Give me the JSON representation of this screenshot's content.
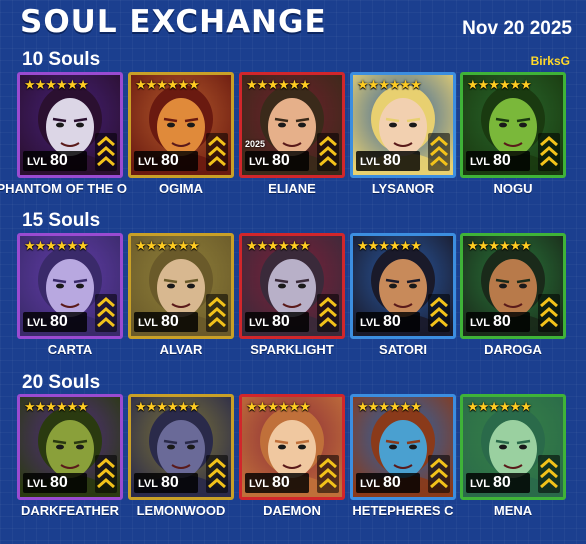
{
  "header": {
    "title": "SOUL EXCHANGE",
    "date": "Nov 20 2025",
    "user": "BirksG"
  },
  "sections": [
    {
      "label": "10 Souls",
      "heroes": [
        {
          "name": "PHANTOM OF THE O",
          "level": "80",
          "stars": 6,
          "frame": "#9a4bd1"
        },
        {
          "name": "OGIMA",
          "level": "80",
          "stars": 6,
          "frame": "#c9a027"
        },
        {
          "name": "ELIANE",
          "level": "80",
          "stars": 6,
          "frame": "#d1262b",
          "badge": "2025"
        },
        {
          "name": "LYSANOR",
          "level": "80",
          "stars": 6,
          "frame": "#3c8ee0"
        },
        {
          "name": "NOGU",
          "level": "80",
          "stars": 6,
          "frame": "#3fb338"
        }
      ]
    },
    {
      "label": "15 Souls",
      "heroes": [
        {
          "name": "CARTA",
          "level": "80",
          "stars": 6,
          "frame": "#9a4bd1"
        },
        {
          "name": "ALVAR",
          "level": "80",
          "stars": 6,
          "frame": "#c9a027"
        },
        {
          "name": "SPARKLIGHT",
          "level": "80",
          "stars": 6,
          "frame": "#d1262b"
        },
        {
          "name": "SATORI",
          "level": "80",
          "stars": 6,
          "frame": "#3c8ee0"
        },
        {
          "name": "DAROGA",
          "level": "80",
          "stars": 6,
          "frame": "#3fb338"
        }
      ]
    },
    {
      "label": "20 Souls",
      "heroes": [
        {
          "name": "DARKFEATHER",
          "level": "80",
          "stars": 6,
          "frame": "#9a4bd1"
        },
        {
          "name": "LEMONWOOD",
          "level": "80",
          "stars": 6,
          "frame": "#c9a027"
        },
        {
          "name": "DAEMON",
          "level": "80",
          "stars": 6,
          "frame": "#d1262b"
        },
        {
          "name": "HETEPHERES C",
          "level": "80",
          "stars": 6,
          "frame": "#3c8ee0"
        },
        {
          "name": "MENA",
          "level": "80",
          "stars": 6,
          "frame": "#3fb338"
        }
      ]
    }
  ],
  "labels": {
    "lvl": "LVL"
  },
  "portrait_palettes": [
    [
      "#4a1a6e",
      "#dcd6e6",
      "#2b1030"
    ],
    [
      "#c85a1a",
      "#e08a3a",
      "#6a1a10"
    ],
    [
      "#7a1a1a",
      "#e6b08a",
      "#3a2a1a"
    ],
    [
      "#3a6aa0",
      "#f2d0b0",
      "#e8d070"
    ],
    [
      "#2a6a1a",
      "#7ab83a",
      "#1a3a10"
    ],
    [
      "#6a3aa8",
      "#b8a8e0",
      "#3a2a6a"
    ],
    [
      "#a0882a",
      "#d8b890",
      "#6a5a2a"
    ],
    [
      "#8a1a2a",
      "#b8b0c8",
      "#3a2a3a"
    ],
    [
      "#2a5aa0",
      "#c88a5a",
      "#1a1a2a"
    ],
    [
      "#2a7a2a",
      "#b87a4a",
      "#1a2a1a"
    ],
    [
      "#5a2a7a",
      "#8aa03a",
      "#2a3a10"
    ],
    [
      "#8a7a2a",
      "#6a6a98",
      "#2a2a4a"
    ],
    [
      "#a02a2a",
      "#f0c8a0",
      "#c0703a"
    ],
    [
      "#2a6ab0",
      "#4aa0d0",
      "#8a3a1a"
    ],
    [
      "#3a8a3a",
      "#9ad0a0",
      "#2a6a4a"
    ]
  ]
}
